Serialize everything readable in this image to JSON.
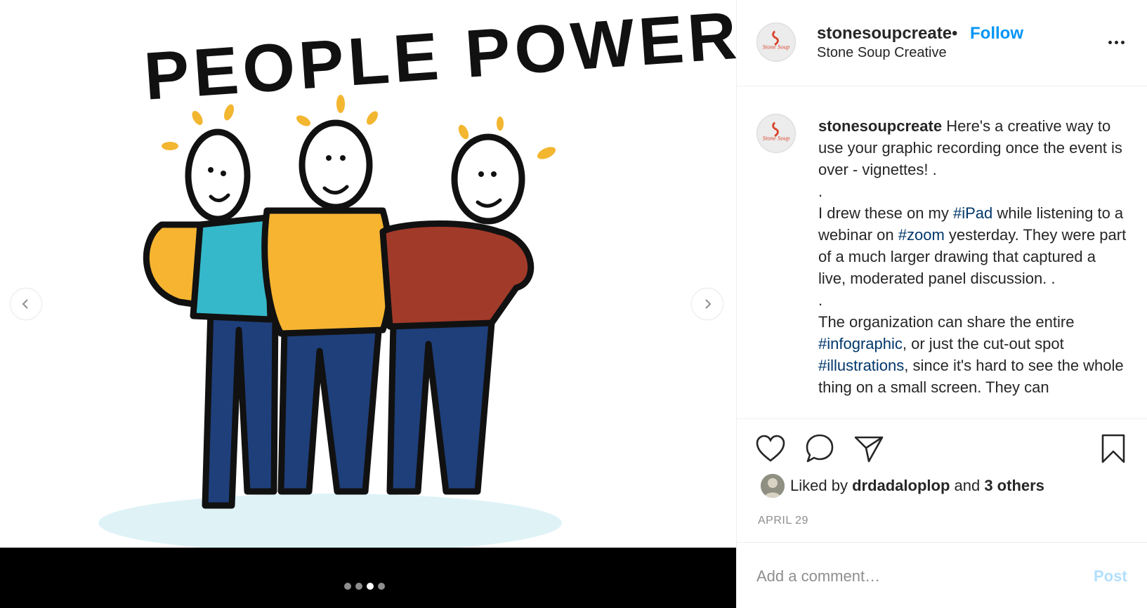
{
  "media": {
    "artwork_text": "PEOPLE POWER",
    "carousel": {
      "count": 4,
      "active_index": 2
    },
    "prev_icon": "chevron-left-icon",
    "next_icon": "chevron-right-icon"
  },
  "header": {
    "username": "stonesoupcreate",
    "separator": "•",
    "follow_label": "Follow",
    "full_name": "Stone Soup Creative",
    "avatar_logo_text": "Stone Soup"
  },
  "caption": {
    "username": "stonesoupcreate",
    "lines": {
      "intro": "Here's a creative way to use your graphic recording once the event is over - vignettes! .",
      "dot1": ".",
      "p2_a": "I drew these on my ",
      "p2_tag1": "#iPad",
      "p2_b": " while listening to a webinar on ",
      "p2_tag2": "#zoom",
      "p2_c": " yesterday. They were part of a much larger drawing that captured a live, moderated panel discussion. .",
      "dot2": ".",
      "p3_a": "The organization can share the entire ",
      "p3_tag1": "#infographic",
      "p3_b": ", or just the cut-out spot ",
      "p3_tag2": "#illustrations",
      "p3_c": ", since it's hard to see the whole thing on a small screen. They can"
    }
  },
  "actions": {
    "icons": [
      "heart-icon",
      "comment-icon",
      "share-icon",
      "bookmark-icon"
    ],
    "liked_prefix": "Liked by ",
    "liked_user": "drdadaloplop",
    "liked_and": " and ",
    "liked_others": "3 others",
    "date": "APRIL 29"
  },
  "comment": {
    "placeholder": "Add a comment…",
    "post_label": "Post"
  },
  "colors": {
    "follow": "#0095f6",
    "hashtag": "#00376b",
    "post_disabled": "#b2dffc",
    "shirt_yellow": "#f6b431",
    "shirt_teal": "#35b8c9",
    "shirt_red": "#a23a2a",
    "pants_blue": "#1e3f7a"
  }
}
